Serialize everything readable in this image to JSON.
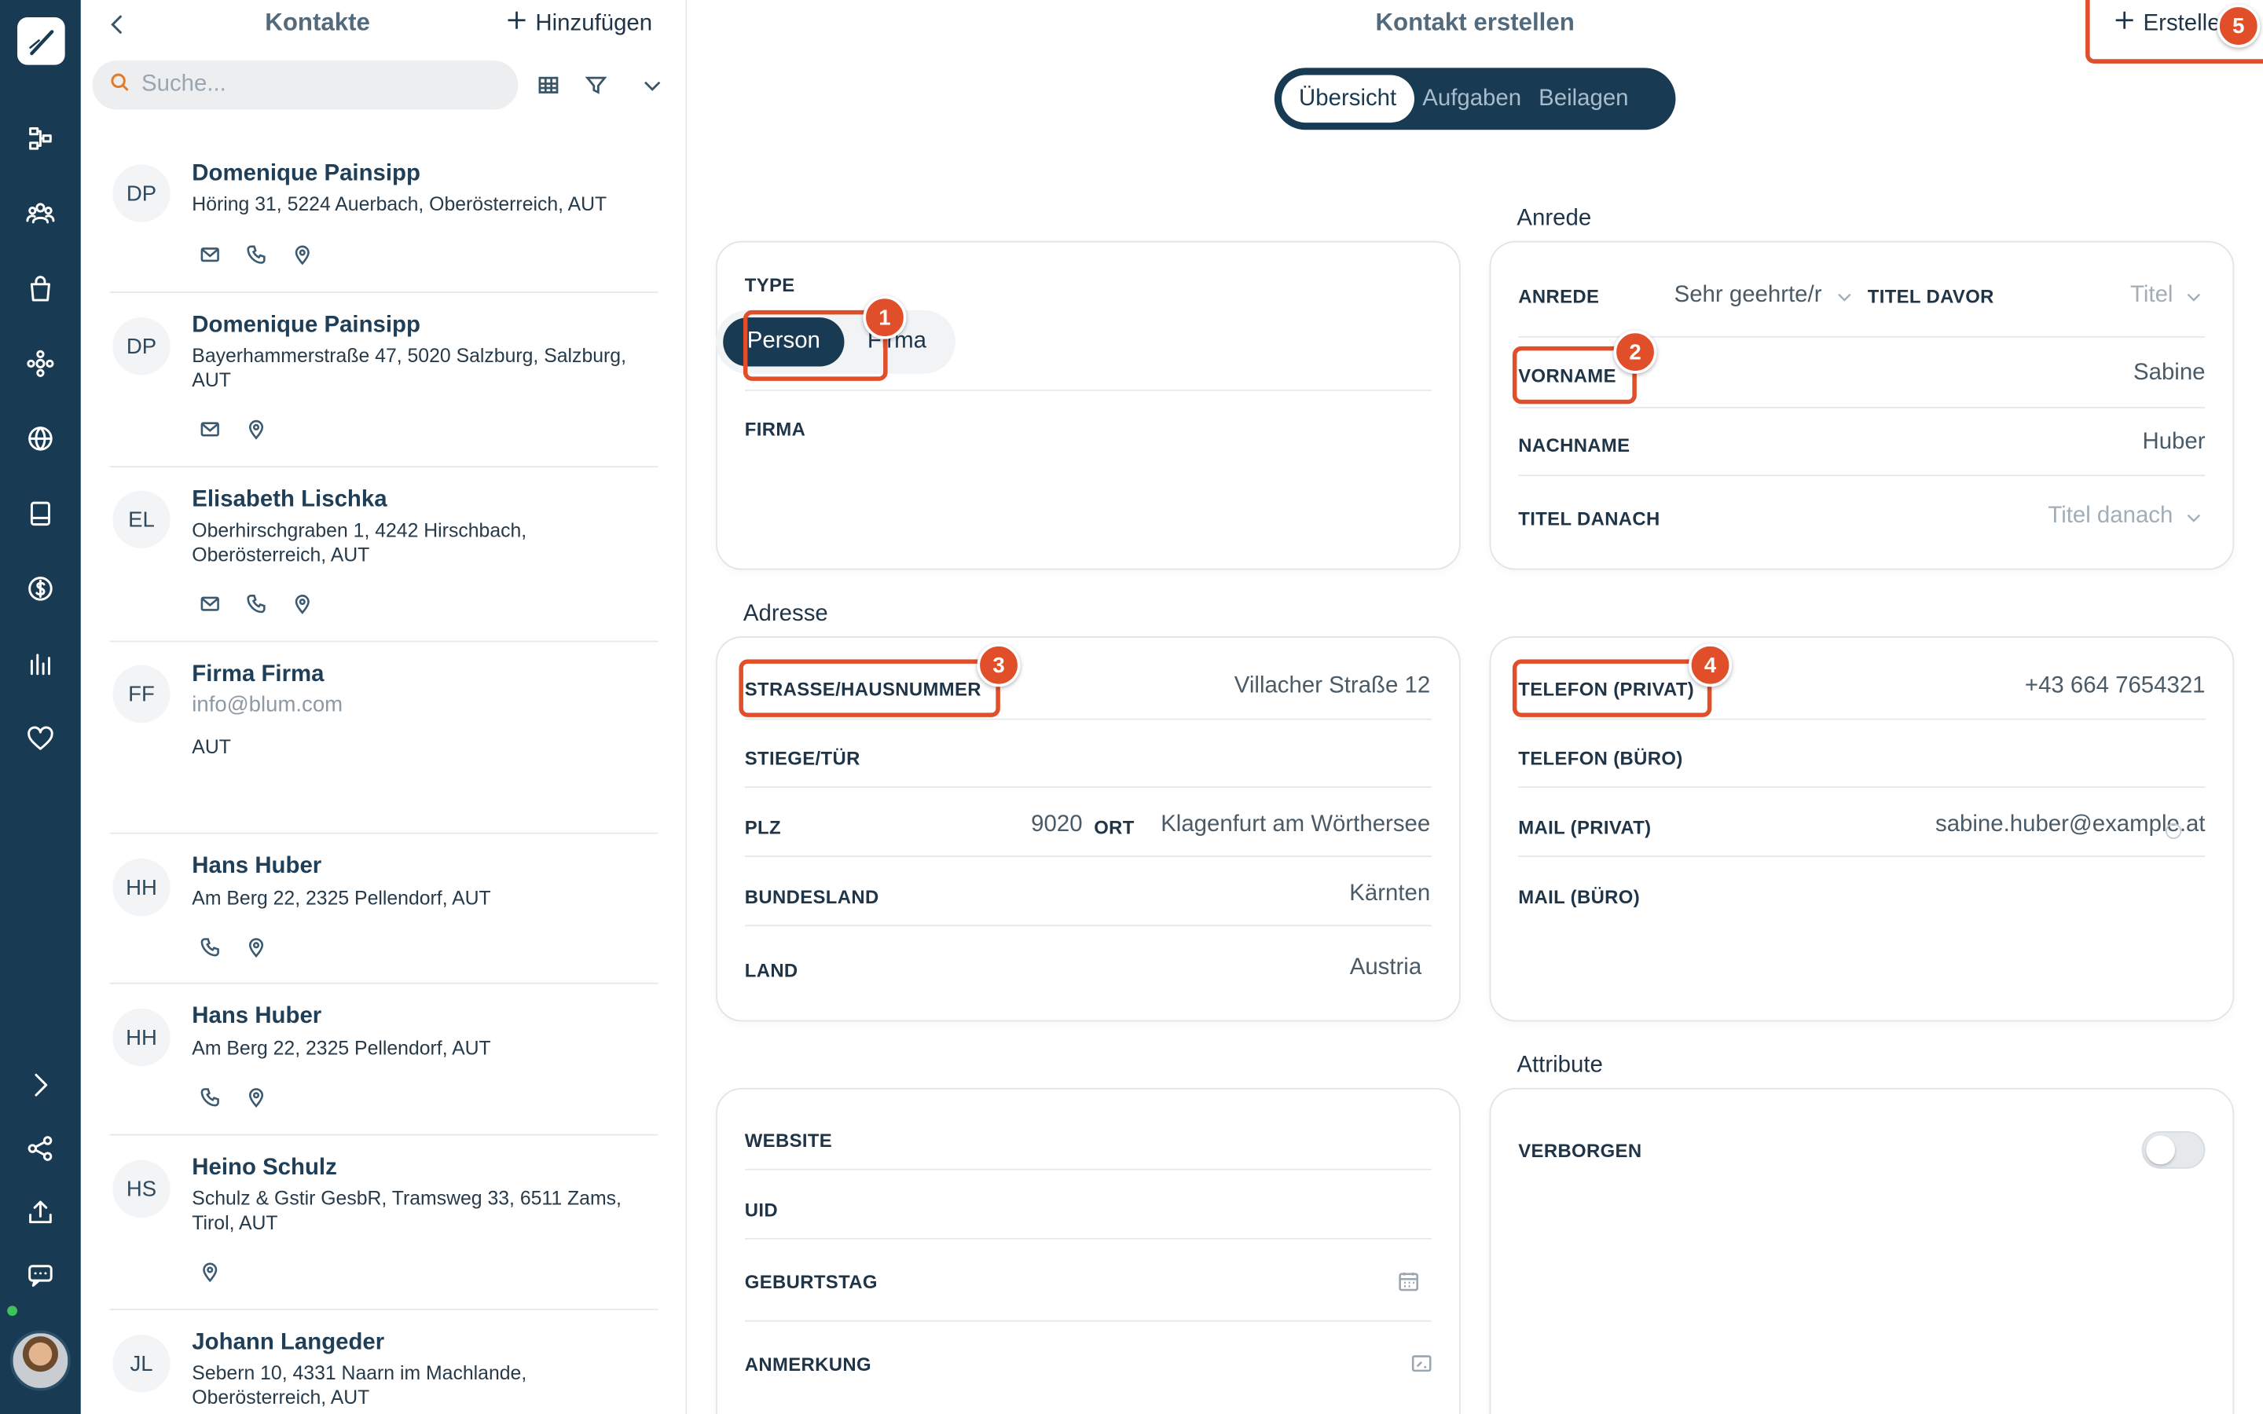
{
  "list": {
    "title": "Kontakte",
    "add_label": "Hinzufügen",
    "search_placeholder": "Suche...",
    "contacts": [
      {
        "initials": "DP",
        "name": "Domenique Painsipp",
        "address": "Höring 31, 5224 Auerbach, Oberösterreich, AUT",
        "icons": [
          "mail-icon",
          "phone-icon",
          "location-icon"
        ]
      },
      {
        "initials": "DP",
        "name": "Domenique Painsipp",
        "address": "Bayerhammerstraße 47, 5020 Salzburg, Salzburg, AUT",
        "icons": [
          "mail-icon",
          "location-icon"
        ]
      },
      {
        "initials": "EL",
        "name": "Elisabeth Lischka",
        "address": "Oberhirschgraben 1, 4242 Hirschbach, Oberösterreich, AUT",
        "icons": [
          "mail-icon",
          "phone-icon",
          "location-icon"
        ]
      },
      {
        "initials": "FF",
        "name": "Firma Firma",
        "email": "info@blum.com",
        "address": "AUT"
      },
      {
        "initials": "HH",
        "name": "Hans Huber",
        "address": "Am Berg 22, 2325 Pellendorf, AUT",
        "icons": [
          "phone-icon",
          "location-icon"
        ]
      },
      {
        "initials": "HH",
        "name": "Hans Huber",
        "address": "Am Berg 22, 2325 Pellendorf, AUT",
        "icons": [
          "phone-icon",
          "location-icon"
        ]
      },
      {
        "initials": "HS",
        "name": "Heino Schulz",
        "address": "Schulz & Gstir GesbR, Tramsweg 33, 6511 Zams, Tirol, AUT",
        "icons": [
          "location-icon"
        ]
      },
      {
        "initials": "JL",
        "name": "Johann Langeder",
        "address": "Sebern 10, 4331 Naarn im Machlande, Oberösterreich, AUT"
      }
    ]
  },
  "main": {
    "title": "Kontakt erstellen",
    "create_label": "Erstellen",
    "tabs": [
      {
        "label": "Übersicht",
        "active": true
      },
      {
        "label": "Aufgaben",
        "active": false
      },
      {
        "label": "Beilagen",
        "active": false
      }
    ]
  },
  "type_panel": {
    "type_label": "TYPE",
    "person_label": "Person",
    "firma_option": "Firma",
    "firma_label": "FIRMA"
  },
  "anrede_panel": {
    "section": "Anrede",
    "anrede_label": "ANREDE",
    "anrede_value": "Sehr geehrte/r",
    "titel_davor_label": "TITEL DAVOR",
    "titel_davor_placeholder": "Titel",
    "vorname_label": "VORNAME",
    "vorname_value": "Sabine",
    "nachname_label": "NACHNAME",
    "nachname_value": "Huber",
    "titel_danach_label": "TITEL DANACH",
    "titel_danach_placeholder": "Titel danach"
  },
  "address_panel": {
    "section": "Adresse",
    "strasse_label": "STRASSE/HAUSNUMMER",
    "strasse_value": "Villacher Straße 12",
    "stiege_label": "STIEGE/TÜR",
    "plz_label": "PLZ",
    "plz_value": "9020",
    "ort_label": "ORT",
    "ort_value": "Klagenfurt am Wörthersee",
    "bundesland_label": "BUNDESLAND",
    "bundesland_value": "Kärnten",
    "land_label": "LAND",
    "land_value": "Austria"
  },
  "contact_panel": {
    "tel_privat_label": "TELEFON (PRIVAT)",
    "tel_privat_value": "+43 664 7654321",
    "tel_buero_label": "TELEFON (BÜRO)",
    "mail_privat_label": "MAIL (PRIVAT)",
    "mail_privat_value": "sabine.huber@example.at",
    "mail_buero_label": "MAIL (BÜRO)"
  },
  "misc_panel": {
    "website_label": "WEBSITE",
    "uid_label": "UID",
    "geburtstag_label": "GEBURTSTAG",
    "anmerkung_label": "ANMERKUNG"
  },
  "attribute_panel": {
    "section": "Attribute",
    "verborgen_label": "VERBORGEN",
    "verborgen_on": false
  },
  "badges": [
    "1",
    "2",
    "3",
    "4",
    "5"
  ],
  "colors": {
    "sidebar": "#183a52",
    "accent": "#183a52",
    "highlight": "#e04e2a"
  }
}
